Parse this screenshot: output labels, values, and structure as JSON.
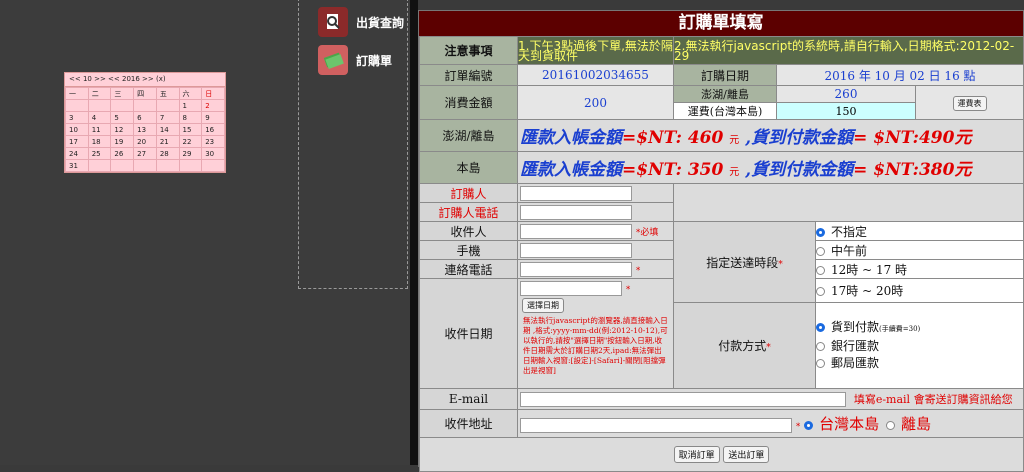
{
  "menu": {
    "item1": "出貨查詢",
    "item2": "訂購單",
    "icon1": "search-doc-icon",
    "icon2": "money-icon"
  },
  "calendar": {
    "header": "<< 10 >>  << 2016 >>  (x)",
    "weekdays": [
      "一",
      "二",
      "三",
      "四",
      "五",
      "六",
      "日"
    ],
    "rows": [
      [
        "",
        "",
        "",
        "",
        "",
        "1",
        "2"
      ],
      [
        "3",
        "4",
        "5",
        "6",
        "7",
        "8",
        "9"
      ],
      [
        "10",
        "11",
        "12",
        "13",
        "14",
        "15",
        "16"
      ],
      [
        "17",
        "18",
        "19",
        "20",
        "21",
        "22",
        "23"
      ],
      [
        "24",
        "25",
        "26",
        "27",
        "28",
        "29",
        "30"
      ],
      [
        "31",
        "",
        "",
        "",
        "",
        "",
        ""
      ]
    ]
  },
  "form": {
    "title": "訂購單填寫",
    "notice_label": "注意事項",
    "notice1": "1.下午3點過後下單,無法於隔天到貨取件",
    "notice2": "2.無法執行javascript的系統時,請自行輸入,日期格式:2012-02-29",
    "order_no_label": "訂單編號",
    "order_no": "20161002034655",
    "order_date_label": "訂購日期",
    "order_date": "2016 年 10 月 02 日 16 點",
    "amount_label": "消費金額",
    "amount": "200",
    "island_label": "澎湖/離島",
    "island_value": "260",
    "shipping_label": "運費(台灣本島)",
    "shipping_value": "150",
    "shipping_btn": "運費表",
    "island_row_label": "澎湖/離島",
    "island_row_text": "匯款入帳金額=$NT: 460 元 ,貨到付款金額= $NT:490元",
    "main_row_label": "本島",
    "main_row_text": "匯款入帳金額=$NT: 350 元 ,貨到付款金額= $NT:380元",
    "buyer_label": "訂購人",
    "buyer_phone_label": "訂購人電話",
    "receiver_label": "收件人",
    "required_text": "*必填",
    "mobile_label": "手機",
    "phone_label": "連絡電話",
    "star": "*",
    "receive_date_label": "收件日期",
    "pick_date_btn": "選擇日期",
    "date_warning": "無法執行javascript的瀏覽器,請直接輸入日期 ,格式:yyyy-mm-dd(例:2012-10-12),可以執行的,請按\"選擇日期\"按鈕輸入日期,收件日期需大於訂購日期2天,ipad:無法彈出日期輸入視窗:[設定]-[Safari]-關閉[阻擋彈出是視窗]",
    "time_label": "指定送達時段",
    "time_options": [
      "不指定",
      "中午前",
      "12時 ~ 17 時",
      "17時 ~ 20時"
    ],
    "time_selected": 0,
    "pay_label": "付款方式",
    "pay_options": [
      "貨到付款",
      "銀行匯款",
      "郵局匯款"
    ],
    "pay_fee_note": "(手續費=30)",
    "email_label": "E-mail",
    "email_note": "填寫e-mail 會寄送訂購資訊給您",
    "address_label": "收件地址",
    "region_main": "台灣本島",
    "region_island": "離島",
    "cancel_btn": "取消訂單",
    "submit_btn": "送出訂單"
  },
  "colors": {
    "title_bg": "#5c0000",
    "label_bg": "#a8b4a0",
    "accent_red": "#e00000",
    "accent_blue": "#1a3fd0"
  }
}
